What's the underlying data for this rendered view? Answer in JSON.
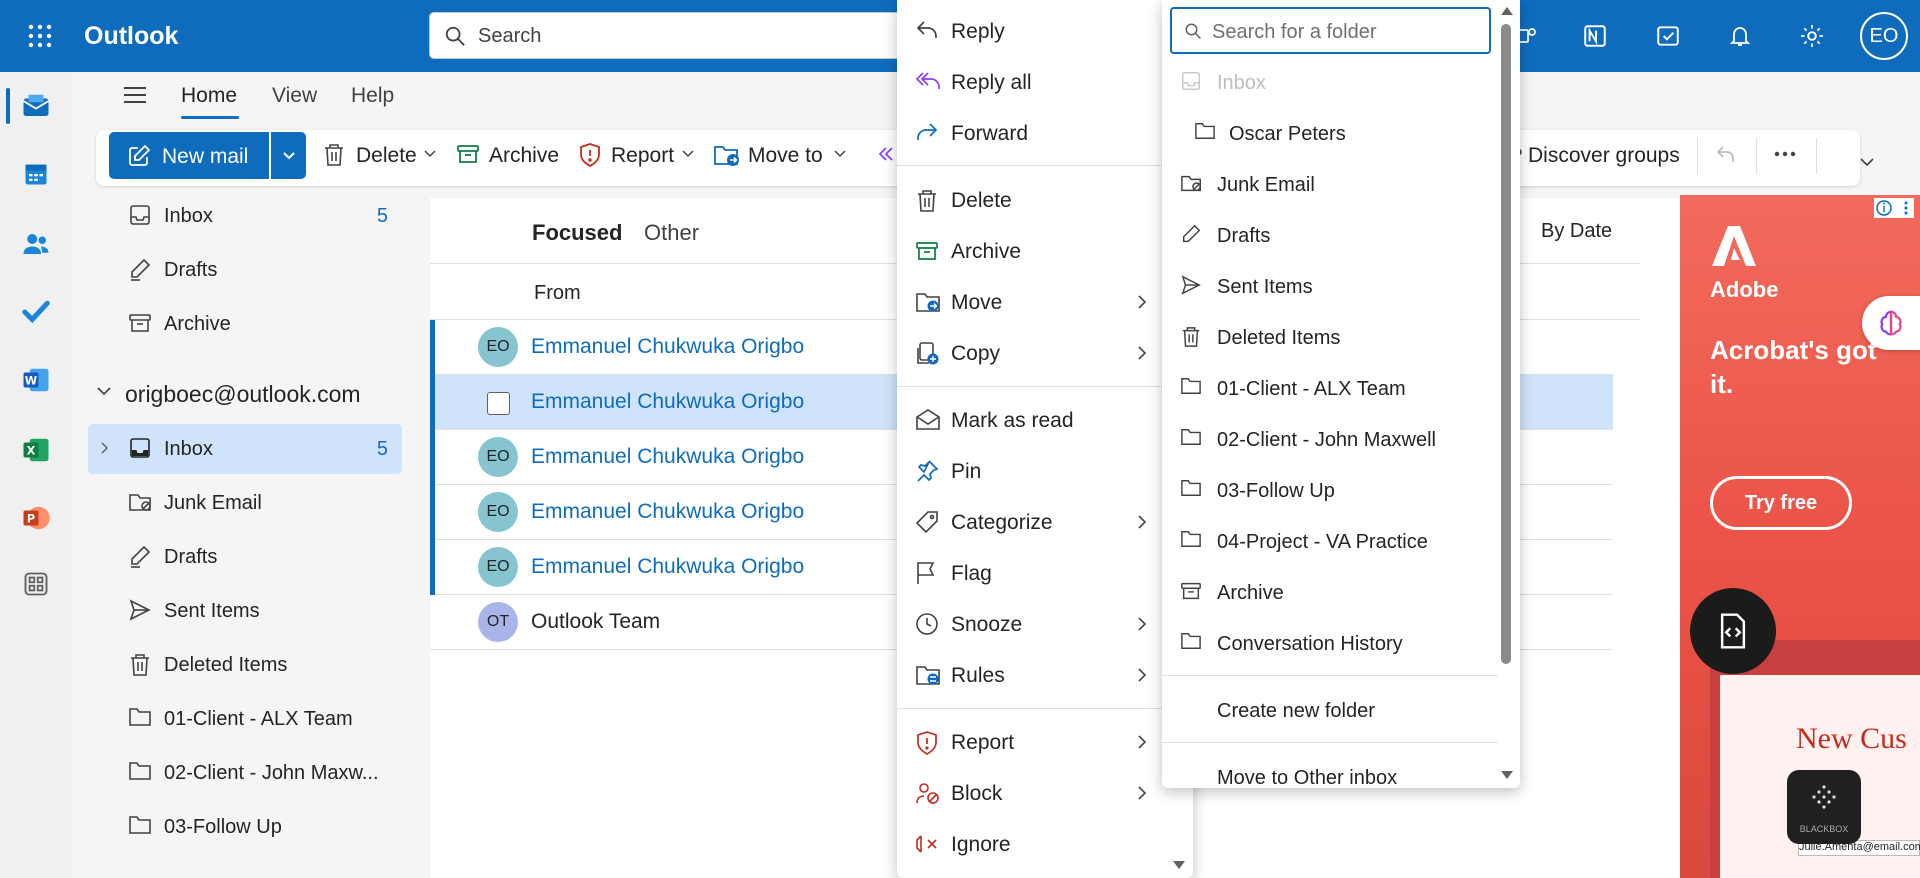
{
  "app": {
    "title": "Outlook",
    "user_initials": "EO"
  },
  "search": {
    "placeholder": "Search"
  },
  "ribbon": {
    "tabs": [
      "Home",
      "View",
      "Help"
    ],
    "new_mail": "New mail",
    "delete": "Delete",
    "archive": "Archive",
    "report": "Report",
    "move_to": "Move to",
    "discover_groups": "Discover groups"
  },
  "folders_top": [
    {
      "label": "Inbox",
      "count": "5"
    },
    {
      "label": "Drafts"
    },
    {
      "label": "Archive"
    }
  ],
  "account": "origboec@outlook.com",
  "folders_account": [
    {
      "label": "Inbox",
      "count": "5"
    },
    {
      "label": "Junk Email"
    },
    {
      "label": "Drafts"
    },
    {
      "label": "Sent Items"
    },
    {
      "label": "Deleted Items"
    },
    {
      "label": "01-Client - ALX Team"
    },
    {
      "label": "02-Client - John Maxw..."
    },
    {
      "label": "03-Follow Up"
    }
  ],
  "mail_list": {
    "tabs": {
      "focused": "Focused",
      "other": "Other"
    },
    "sort": "By Date",
    "column_from": "From",
    "rows": [
      {
        "initials": "EO",
        "sender": "Emmanuel Chukwuka Origbo"
      },
      {
        "initials": "",
        "sender": "Emmanuel Chukwuka Origbo"
      },
      {
        "initials": "EO",
        "sender": "Emmanuel Chukwuka Origbo"
      },
      {
        "initials": "EO",
        "sender": "Emmanuel Chukwuka Origbo"
      },
      {
        "initials": "EO",
        "sender": "Emmanuel Chukwuka Origbo"
      },
      {
        "initials": "OT",
        "sender": "Outlook Team"
      }
    ]
  },
  "context_menu": [
    {
      "label": "Reply"
    },
    {
      "label": "Reply all"
    },
    {
      "label": "Forward"
    },
    {
      "label": "Delete"
    },
    {
      "label": "Archive"
    },
    {
      "label": "Move"
    },
    {
      "label": "Copy"
    },
    {
      "label": "Mark as read"
    },
    {
      "label": "Pin"
    },
    {
      "label": "Categorize"
    },
    {
      "label": "Flag"
    },
    {
      "label": "Snooze"
    },
    {
      "label": "Rules"
    },
    {
      "label": "Report"
    },
    {
      "label": "Block"
    },
    {
      "label": "Ignore"
    }
  ],
  "move_submenu": {
    "search_placeholder": "Search for a folder",
    "folders": [
      "Inbox",
      "Oscar Peters",
      "Junk Email",
      "Drafts",
      "Sent Items",
      "Deleted Items",
      "01-Client - ALX Team",
      "02-Client - John Maxwell",
      "03-Follow Up",
      "04-Project - VA Practice",
      "Archive",
      "Conversation History"
    ],
    "create_new_folder": "Create new folder",
    "move_to_other_inbox": "Move to Other inbox"
  },
  "ad": {
    "brand": "Adobe",
    "headline": "Acrobat's got it.",
    "cta": "Try free",
    "preview_title": "New Cus",
    "preview_email": "Julie.Amenta@email.com"
  },
  "badges": {
    "blackbox": "BLACKBOX"
  },
  "colors": {
    "brand": "#0f6cbd",
    "selection": "#cfe4fa",
    "ad": "#ea5245"
  }
}
